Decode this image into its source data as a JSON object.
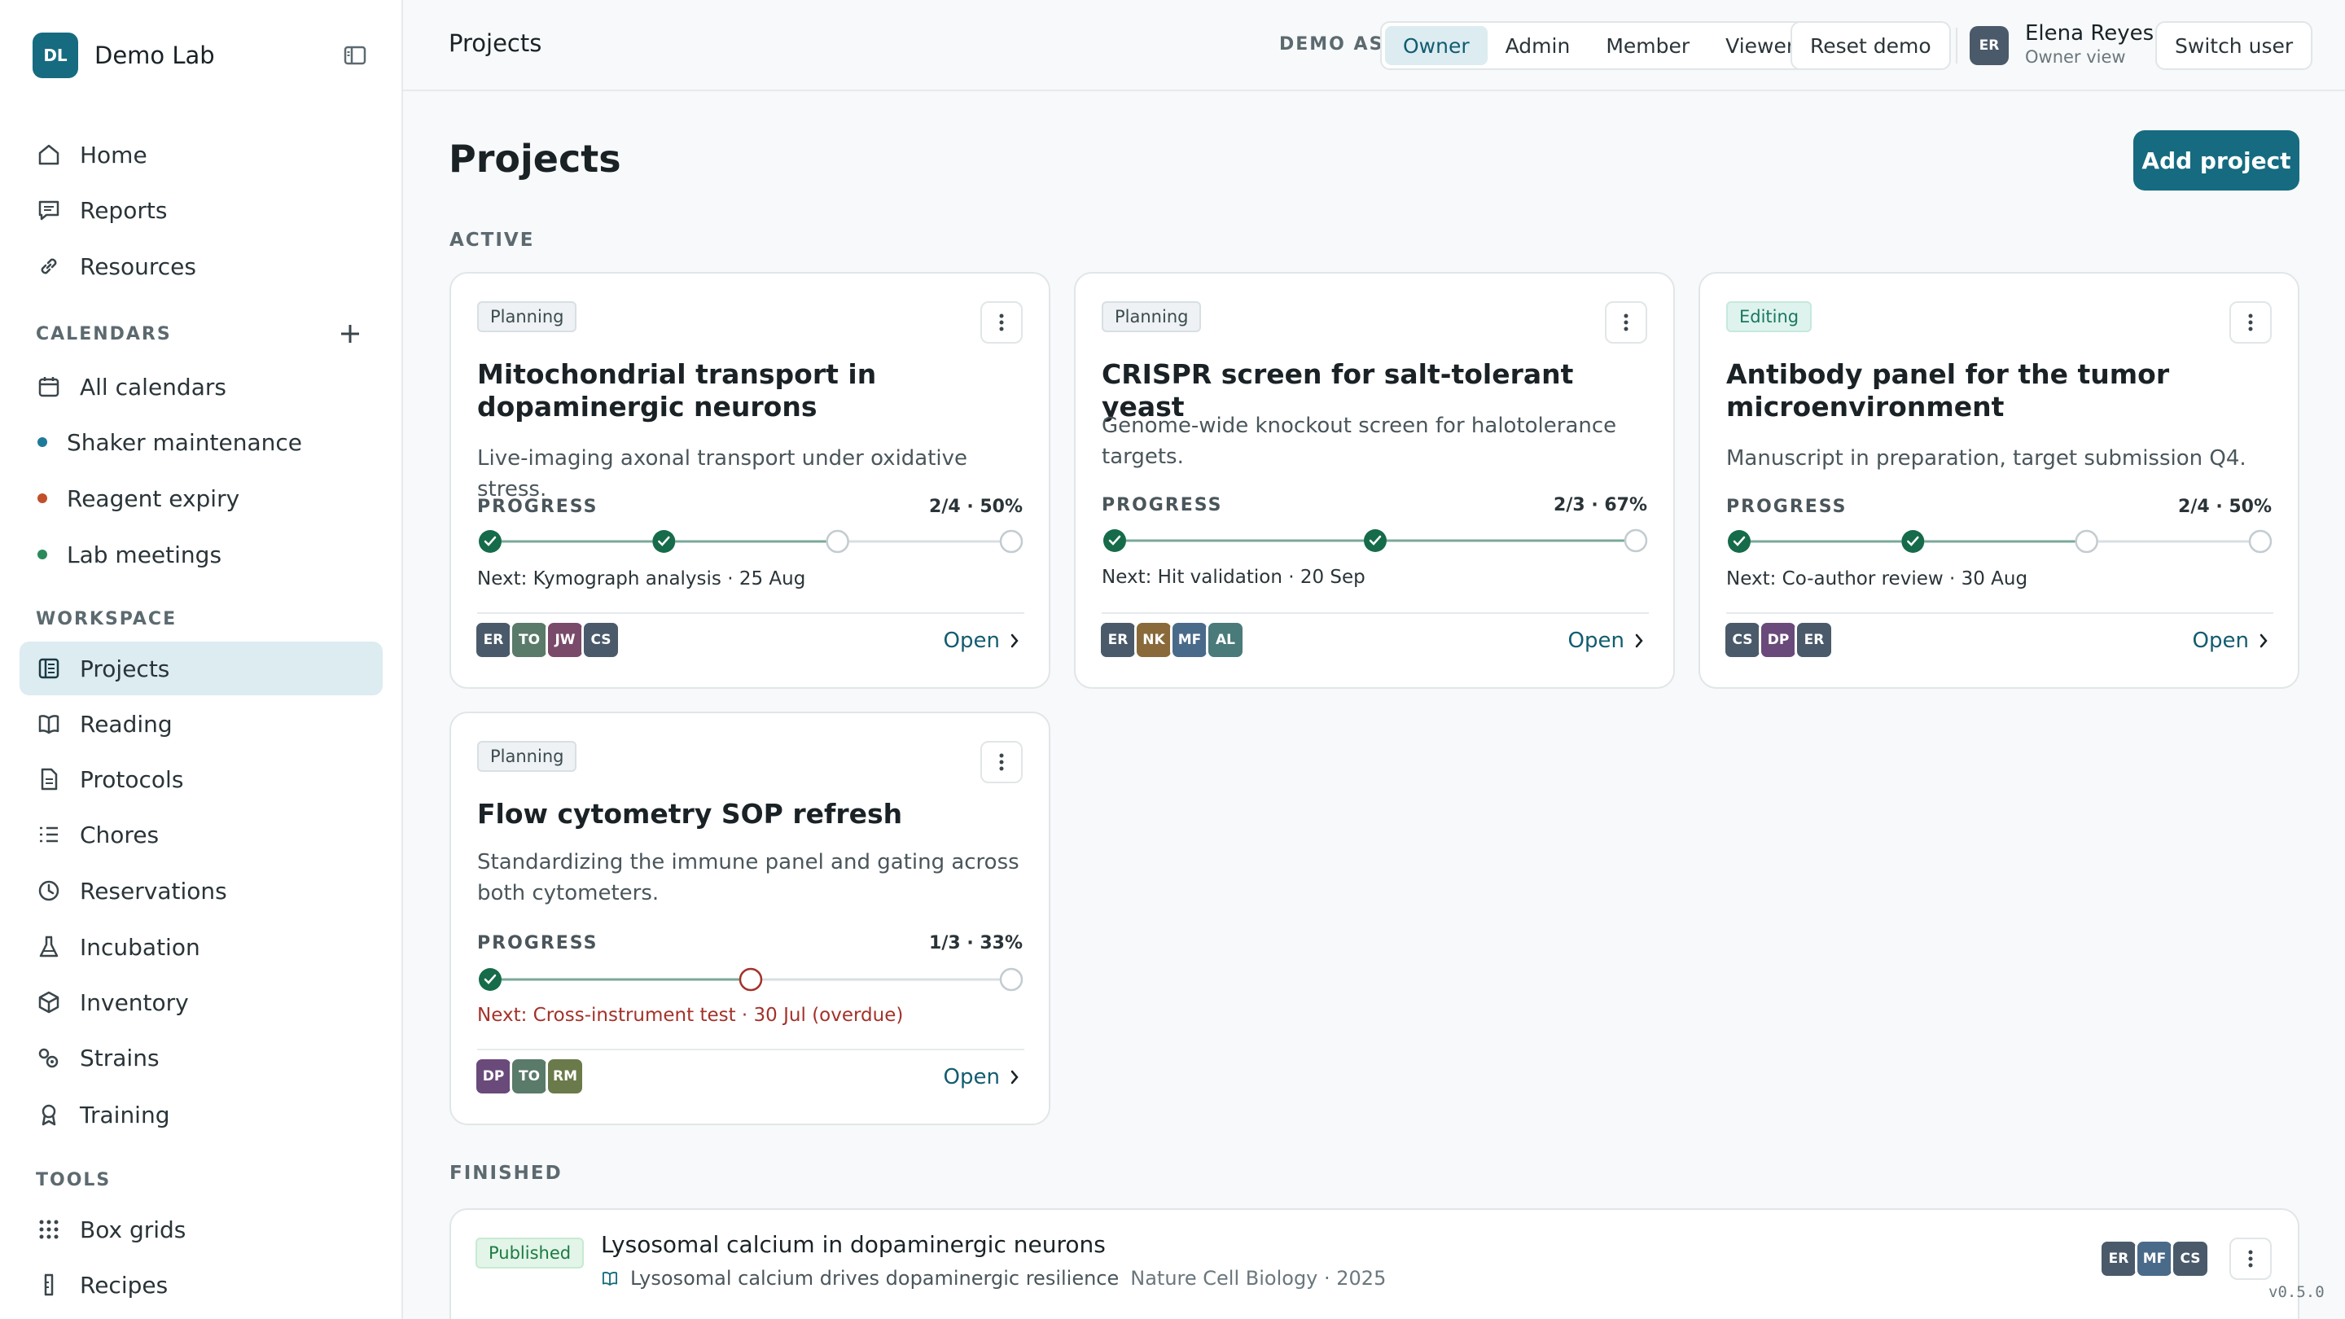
{
  "app": {
    "logo_initials": "DL",
    "name": "Demo Lab"
  },
  "sidebar": {
    "main": [
      {
        "label": "Home",
        "icon": "home-icon"
      },
      {
        "label": "Reports",
        "icon": "chat-icon"
      },
      {
        "label": "Resources",
        "icon": "link-icon"
      }
    ],
    "calendars_title": "CALENDARS",
    "calendars": [
      {
        "label": "All calendars",
        "icon": "calendar-icon"
      },
      {
        "label": "Shaker maintenance",
        "color": "#1f7a9a"
      },
      {
        "label": "Reagent expiry",
        "color": "#c0502a"
      },
      {
        "label": "Lab meetings",
        "color": "#2a8a5a"
      }
    ],
    "workspace_title": "WORKSPACE",
    "workspace": [
      {
        "label": "Projects",
        "icon": "projects-icon",
        "active": true
      },
      {
        "label": "Reading",
        "icon": "book-icon"
      },
      {
        "label": "Protocols",
        "icon": "document-icon"
      },
      {
        "label": "Chores",
        "icon": "checklist-icon"
      },
      {
        "label": "Reservations",
        "icon": "clock-icon"
      },
      {
        "label": "Incubation",
        "icon": "flask-icon"
      },
      {
        "label": "Inventory",
        "icon": "box-icon"
      },
      {
        "label": "Strains",
        "icon": "strains-icon"
      },
      {
        "label": "Training",
        "icon": "ribbon-icon"
      }
    ],
    "tools_title": "TOOLS",
    "tools": [
      {
        "label": "Box grids",
        "icon": "grid-icon"
      },
      {
        "label": "Recipes",
        "icon": "beaker-icon"
      }
    ]
  },
  "topbar": {
    "title": "Projects",
    "demo_as": "DEMO AS",
    "roles": [
      "Owner",
      "Admin",
      "Member",
      "Viewer"
    ],
    "active_role": "Owner",
    "reset": "Reset demo",
    "user": {
      "initials": "ER",
      "name": "Elena Reyes",
      "role": "Owner view"
    },
    "switch_user": "Switch user"
  },
  "main": {
    "title": "Projects",
    "add_project": "Add project",
    "active_title": "ACTIVE",
    "finished_title": "FINISHED",
    "progress_label": "PROGRESS",
    "open_label": "Open",
    "projects": [
      {
        "status": "Planning",
        "title": "Mitochondrial transport in dopaminergic neurons",
        "description": "Live-imaging axonal transport under oxidative stress.",
        "progress_text": "2/4 · 50%",
        "steps": [
          "done",
          "done",
          "todo",
          "todo"
        ],
        "next": "Next: Kymograph analysis · 25 Aug",
        "overdue": false,
        "members": [
          {
            "initials": "ER",
            "color": "#4a5a6a"
          },
          {
            "initials": "TO",
            "color": "#5a7a6a"
          },
          {
            "initials": "JW",
            "color": "#7a4a6a"
          },
          {
            "initials": "CS",
            "color": "#4a5a6a"
          }
        ]
      },
      {
        "status": "Planning",
        "title": "CRISPR screen for salt-tolerant yeast",
        "description": "Genome-wide knockout screen for halotolerance targets.",
        "progress_text": "2/3 · 67%",
        "steps": [
          "done",
          "done",
          "todo"
        ],
        "next": "Next: Hit validation · 20 Sep",
        "overdue": false,
        "members": [
          {
            "initials": "ER",
            "color": "#4a5a6a"
          },
          {
            "initials": "NK",
            "color": "#8a6a3a"
          },
          {
            "initials": "MF",
            "color": "#4a6a8a"
          },
          {
            "initials": "AL",
            "color": "#4a7a7a"
          }
        ]
      },
      {
        "status": "Editing",
        "title": "Antibody panel for the tumor microenvironment",
        "description": "Manuscript in preparation, target submission Q4.",
        "progress_text": "2/4 · 50%",
        "steps": [
          "done",
          "done",
          "todo",
          "todo"
        ],
        "next": "Next: Co-author review · 30 Aug",
        "overdue": false,
        "members": [
          {
            "initials": "CS",
            "color": "#4a5a6a"
          },
          {
            "initials": "DP",
            "color": "#6a4a7a"
          },
          {
            "initials": "ER",
            "color": "#4a5a6a"
          }
        ]
      },
      {
        "status": "Planning",
        "title": "Flow cytometry SOP refresh",
        "description": "Standardizing the immune panel and gating across both cytometers.",
        "progress_text": "1/3 · 33%",
        "steps": [
          "done",
          "overdue",
          "todo"
        ],
        "next": "Next: Cross-instrument test · 30 Jul (overdue)",
        "overdue": true,
        "members": [
          {
            "initials": "DP",
            "color": "#6a4a7a"
          },
          {
            "initials": "TO",
            "color": "#5a7a6a"
          },
          {
            "initials": "RM",
            "color": "#6a7a4a"
          }
        ]
      }
    ],
    "finished": [
      {
        "status": "Published",
        "title": "Lysosomal calcium in dopaminergic neurons",
        "paper": "Lysosomal calcium drives dopaminergic resilience",
        "journal": "Nature Cell Biology · 2025",
        "members": [
          {
            "initials": "ER",
            "color": "#4a5a6a"
          },
          {
            "initials": "MF",
            "color": "#4a6a8a"
          },
          {
            "initials": "CS",
            "color": "#4a5a6a"
          }
        ]
      }
    ]
  },
  "version": "v0.5.0",
  "colors": {
    "accent": "#166b80",
    "done": "#166b4a",
    "overdue": "#a3322a"
  }
}
